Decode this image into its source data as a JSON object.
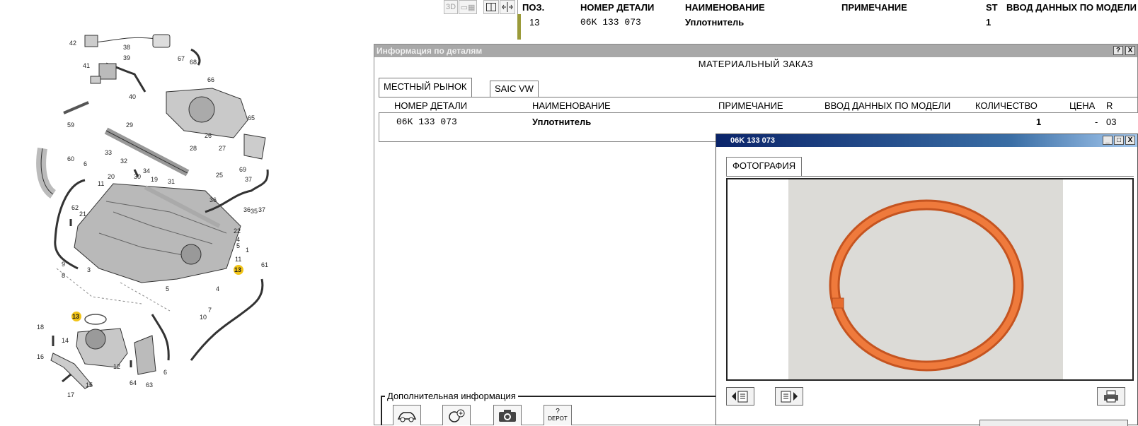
{
  "toolbar": {
    "btn_3d": "3D"
  },
  "top_table": {
    "headers": {
      "pos": "ПОЗ.",
      "part_no": "НОМЕР ДЕТАЛИ",
      "name": "НАИМЕНОВАНИЕ",
      "note": "ПРИМЕЧАНИЕ",
      "st": "ST",
      "model": "ВВОД ДАННЫХ ПО МОДЕЛИ"
    },
    "row": {
      "pos": "13",
      "part_no": "06K 133 073",
      "name": "Уплотнитель",
      "st": "1"
    }
  },
  "info_window": {
    "title": "Информация по деталям",
    "help": "?",
    "close": "X",
    "heading": "МАТЕРИАЛЬНЫЙ ЗАКАЗ",
    "tabs": [
      "МЕСТНЫЙ РЫНОК",
      "SAIC VW"
    ],
    "headers": {
      "part_no": "НОМЕР ДЕТАЛИ",
      "name": "НАИМЕНОВАНИЕ",
      "note": "ПРИМЕЧАНИЕ",
      "model": "ВВОД ДАННЫХ ПО МОДЕЛИ",
      "qty": "КОЛИЧЕСТВО",
      "price": "ЦЕНА",
      "r": "R"
    },
    "row": {
      "part_no": "06K 133 073",
      "name": "Уплотнитель",
      "qty": "1",
      "price": "-",
      "r": "03"
    },
    "additional_info": "Дополнительная информация",
    "bottom_icons": [
      {
        "name": "car-icon"
      },
      {
        "name": "search-plus-icon"
      },
      {
        "name": "camera-icon"
      },
      {
        "name": "depot-icon",
        "label_q": "?",
        "label": "DEPOT"
      }
    ]
  },
  "photo_window": {
    "title": "06K 133 073",
    "tab": "ФОТОГРАФИЯ",
    "min": "_",
    "max": "□",
    "close": "X"
  },
  "diagram": {
    "labels": [
      "42",
      "38",
      "39",
      "41",
      "40",
      "67",
      "68",
      "66",
      "59",
      "65",
      "29",
      "33",
      "26",
      "28",
      "27",
      "25",
      "60",
      "6",
      "32",
      "34",
      "30",
      "31",
      "20",
      "19",
      "69",
      "37",
      "11",
      "62",
      "21",
      "36",
      "35",
      "22",
      "4",
      "5",
      "1",
      "11",
      "9",
      "8",
      "3",
      "13",
      "61",
      "5",
      "4",
      "7",
      "10",
      "13",
      "18",
      "14",
      "16",
      "12",
      "64",
      "63",
      "6",
      "15",
      "17"
    ]
  },
  "colors": {
    "accent": "#9b9b3a",
    "photo_title": "#0a246a",
    "seal": "#e76a2c",
    "callout": "#f2c417"
  }
}
